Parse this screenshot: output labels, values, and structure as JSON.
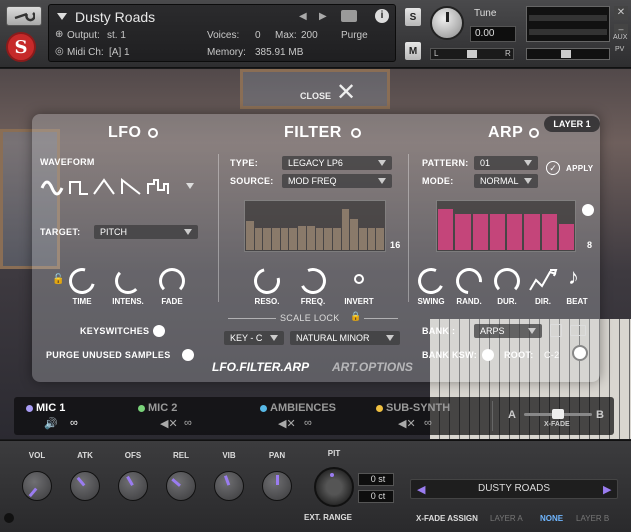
{
  "header": {
    "instrument_name": "Dusty Roads",
    "output_label": "Output:",
    "output_value": "st. 1",
    "midi_label": "Midi Ch:",
    "midi_value": "[A] 1",
    "voices_label": "Voices:",
    "voices_value": "0",
    "max_label": "Max:",
    "max_value": "200",
    "purge_label": "Purge",
    "memory_label": "Memory:",
    "memory_value": "385.91 MB",
    "solo_label": "S",
    "mute_label": "M",
    "tune_label": "Tune",
    "tune_value": "0.00",
    "pan_l": "L",
    "pan_r": "R",
    "aux_label": "AUX",
    "pv_label": "PV"
  },
  "close_label": "CLOSE",
  "layer_badge": "LAYER 1",
  "lfo": {
    "title": "LFO",
    "waveform_label": "WAVEFORM",
    "target_label": "TARGET:",
    "target_value": "PITCH",
    "knobs": [
      "TIME",
      "INTENS.",
      "FADE"
    ],
    "keyswitches_label": "KEYSWITCHES",
    "purge_samples_label": "PURGE UNUSED SAMPLES"
  },
  "filter": {
    "title": "FILTER",
    "type_label": "TYPE:",
    "type_value": "LEGACY LP6",
    "source_label": "SOURCE:",
    "source_value": "MOD FREQ",
    "steps_count": "16",
    "steps": [
      0.6,
      0.45,
      0.45,
      0.45,
      0.45,
      0.45,
      0.5,
      0.5,
      0.45,
      0.45,
      0.45,
      0.85,
      0.65,
      0.45,
      0.45,
      0.45
    ],
    "knobs": [
      "RESO.",
      "FREQ.",
      "INVERT"
    ],
    "scale_lock_label": "SCALE LOCK",
    "key_value": "KEY - C",
    "scale_value": "NATURAL MINOR"
  },
  "arp": {
    "title": "ARP",
    "pattern_label": "PATTERN:",
    "pattern_value": "01",
    "mode_label": "MODE:",
    "mode_value": "NORMAL",
    "apply_label": "APPLY",
    "steps_count": "8",
    "steps": [
      0.85,
      0.75,
      0.75,
      0.75,
      0.75,
      0.75,
      0.75,
      0.55
    ],
    "knobs": [
      "SWING",
      "RAND.",
      "DUR.",
      "DIR.",
      "BEAT"
    ],
    "bank_label": "BANK :",
    "bank_value": "ARPS",
    "bank_ksw_label": "BANK KSW:",
    "root_label": "ROOT:",
    "root_value": "C-2"
  },
  "tabs": {
    "lfo_filter_arp": "LFO.FILTER.ARP",
    "art_options": "ART.OPTIONS"
  },
  "mics": [
    {
      "name": "MIC 1",
      "color": "#a99cf5"
    },
    {
      "name": "MIC 2",
      "color": "#79d279"
    },
    {
      "name": "AMBIENCES",
      "color": "#57b8e6"
    },
    {
      "name": "SUB-SYNTH",
      "color": "#f0c040"
    }
  ],
  "xfade": {
    "a": "A",
    "b": "B",
    "label": "X-FADE"
  },
  "bottom": {
    "knobs": [
      "VOL",
      "ATK",
      "OFS",
      "REL",
      "VIB",
      "PAN",
      "PIT"
    ],
    "st_value": "0 st",
    "ct_value": "0 ct",
    "ext_range_label": "EXT. RANGE",
    "preset_name": "DUSTY ROADS",
    "xfade_assign_label": "X-FADE ASSIGN",
    "assign_options": [
      "LAYER A",
      "NONE",
      "LAYER B"
    ],
    "assign_selected": "NONE"
  },
  "colors": {
    "accent": "#9a7cf0",
    "arp_bar": "#c4457a",
    "filter_bar": "#8a7a6a"
  }
}
